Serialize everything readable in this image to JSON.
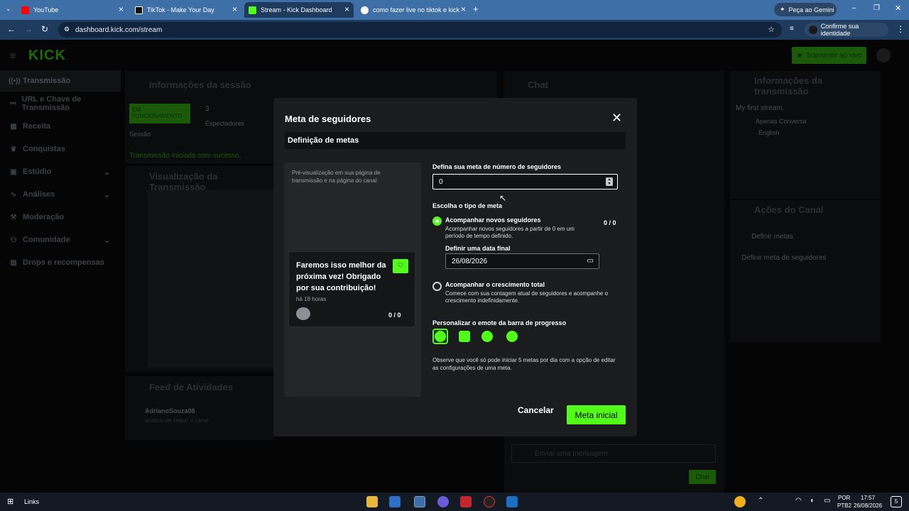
{
  "browser": {
    "tabs": [
      {
        "label": "YouTube"
      },
      {
        "label": "TikTok - Make Your Day"
      },
      {
        "label": "Stream - Kick Dashboard"
      },
      {
        "label": "como fazer live no tiktok e kick"
      }
    ],
    "gemini": "Peça ao Gemini",
    "url": "dashboard.kick.com/stream",
    "identity": "Confirme sua identidade"
  },
  "kick": {
    "logo": "KICK",
    "go_live": "Transmitir ao vivo",
    "sidebar": [
      {
        "label": "Transmissão"
      },
      {
        "label": "URL e Chave de Transmissão"
      },
      {
        "label": "Receita"
      },
      {
        "label": "Conquistas"
      },
      {
        "label": "Estúdio"
      },
      {
        "label": "Análises"
      },
      {
        "label": "Moderação"
      },
      {
        "label": "Comunidade"
      },
      {
        "label": "Drops e recompensas"
      }
    ],
    "session": {
      "title": "Informações da sessão",
      "status": "EM FUNCIONAMENTO",
      "session_label": "Sessão",
      "viewers": "3",
      "viewers_label": "Espectadores",
      "success": "Transmissão iniciada com sucesso."
    },
    "preview_title": "Visualização da Transmissão",
    "chat": {
      "title": "Chat",
      "placeholder": "Enviar uma mensagem",
      "send": "Chat"
    },
    "stream_info": {
      "title": "Informações da transmissão",
      "stream_title": "My first stream.",
      "category": "Apenas Conversa",
      "language": "English"
    },
    "channel_actions": {
      "title": "Ações do Canal",
      "back": "Definir metas",
      "item": "Definir meta de seguidores"
    },
    "feed": {
      "title": "Feed de Atividades",
      "user": "AdrianoSouza08",
      "action": "acabou de seguir o canal"
    }
  },
  "modal": {
    "title": "Meta de seguidores",
    "tab": "Definição de metas",
    "preview_hint": "Pré-visualização em sua página de transmissão e na página do canal",
    "card_message": "Faremos isso melhor da próxima vez! Obrigado por sua contribuição!",
    "card_time": "há 18 horas",
    "card_count": "0 / 0",
    "goal_label": "Defina sua meta de número de seguidores",
    "goal_value": "0",
    "type_label": "Escolha o tipo de meta",
    "option1_title": "Acompanhar novos seguidores",
    "option1_desc": "Acompanhar novos seguidores a partir de 0 em um período de tempo definido.",
    "option1_count": "0 / 0",
    "end_date_label": "Definir uma data final",
    "end_date": "26/08/2026",
    "option2_title": "Acompanhar o crescimento total",
    "option2_desc": "Comece com sua contagem atual de seguidores e acompanhe o crescimento indefinidamente.",
    "emote_label": "Personalizar o emote da barra de progresso",
    "note": "Observe que você só pode iniciar 5 metas por dia com a opção de editar as configurações de uma meta.",
    "cancel": "Cancelar",
    "submit": "Meta inicial"
  },
  "taskbar": {
    "links": "Links",
    "lang1": "POR",
    "lang2": "PTB2",
    "time": "17:57",
    "date": "26/08/2026",
    "badge": "5"
  },
  "colors": {
    "accent": "#53fc18",
    "tabbar": "#3f6fa7",
    "modal": "#1a1c1e"
  }
}
